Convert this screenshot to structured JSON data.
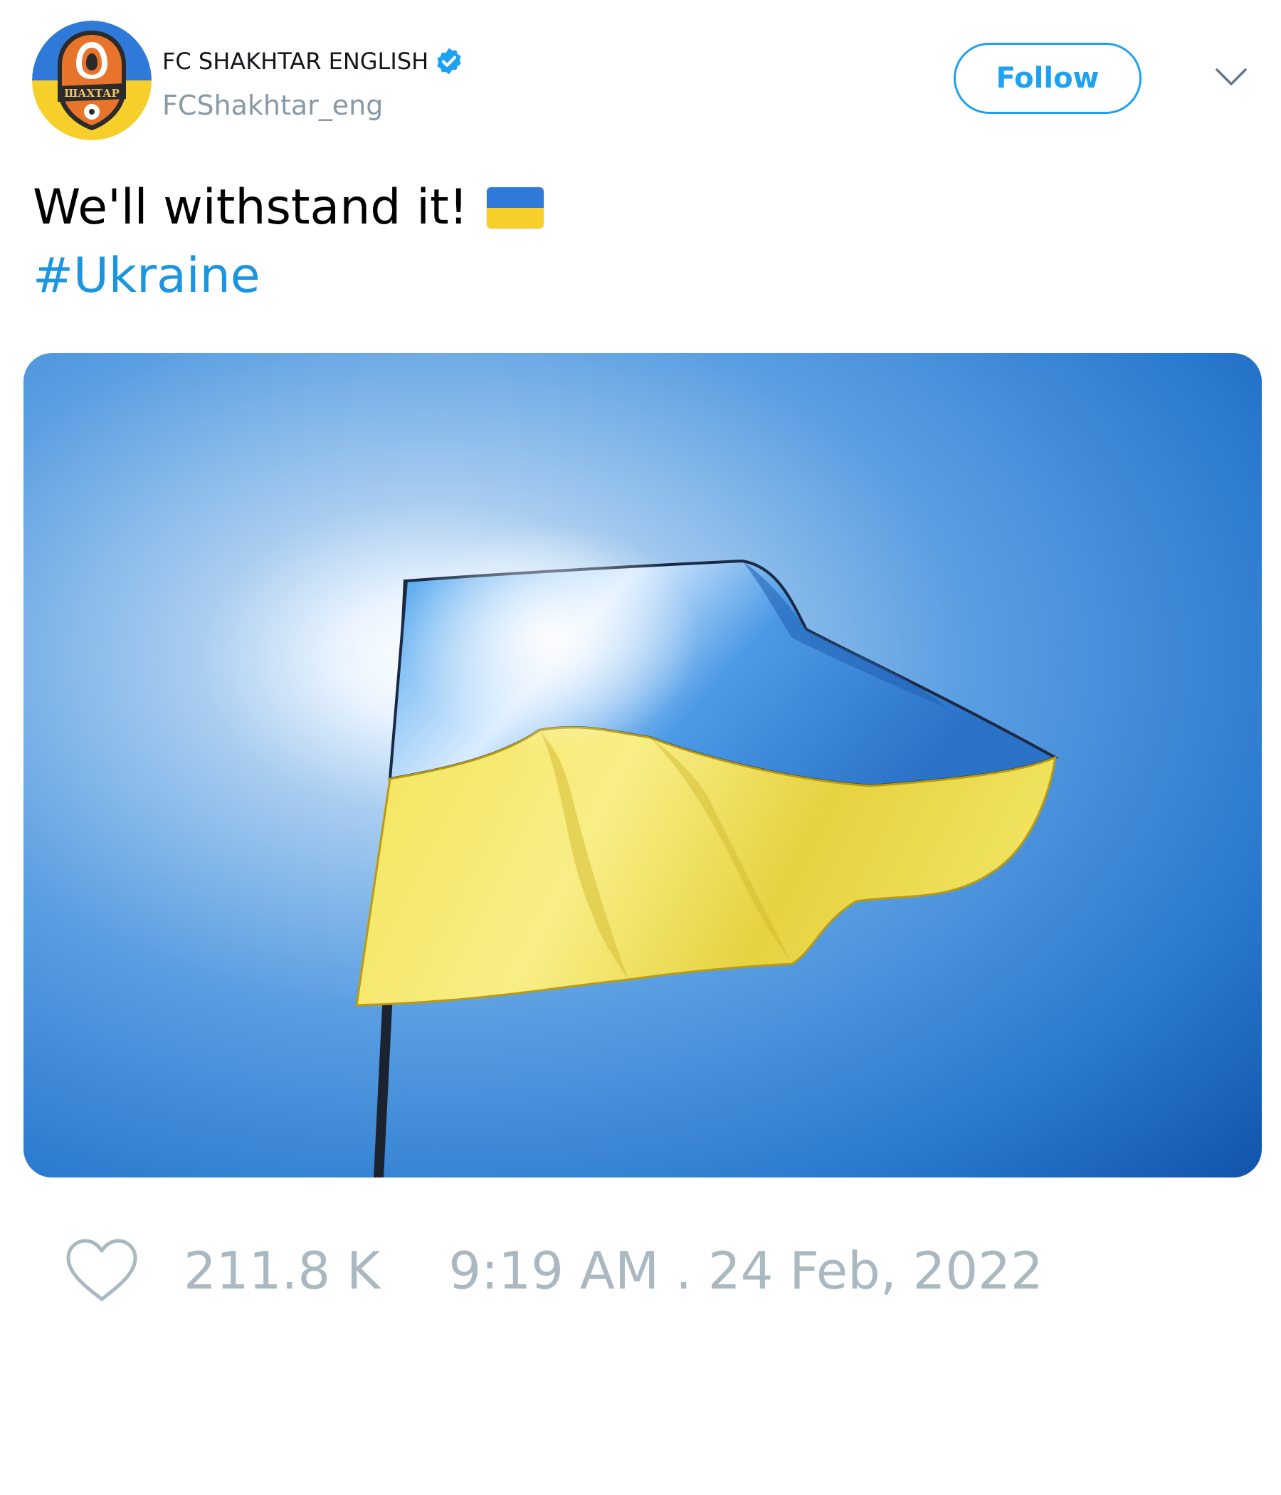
{
  "account": {
    "display_name": "FC SHAKHTAR ENGLISH",
    "handle": "FCShakhtar_eng",
    "verified": true,
    "avatar_icon": "shakhtar-club-crest",
    "avatar_colors": {
      "top": "#2f7ad8",
      "bottom": "#f7cf2b",
      "crest": "#e8732a"
    }
  },
  "header": {
    "follow_label": "Follow",
    "menu_icon": "chevron-down-icon"
  },
  "tweet": {
    "text": "We'll withstand it!",
    "emoji": "ukraine-flag-emoji",
    "hashtag": "#Ukraine"
  },
  "media": {
    "description_icon": "ukraine-flag-photo",
    "colors": {
      "sky": "#1f6fc8",
      "flag_blue": "#3f95e6",
      "flag_yellow": "#f2e05a"
    }
  },
  "stats": {
    "like_icon": "heart-icon",
    "likes": "211.8 K",
    "timestamp": "9:19 AM . 24 Feb, 2022"
  },
  "colors": {
    "accent": "#1da1f2",
    "muted": "#aab8c2",
    "link": "#1b95e0"
  }
}
